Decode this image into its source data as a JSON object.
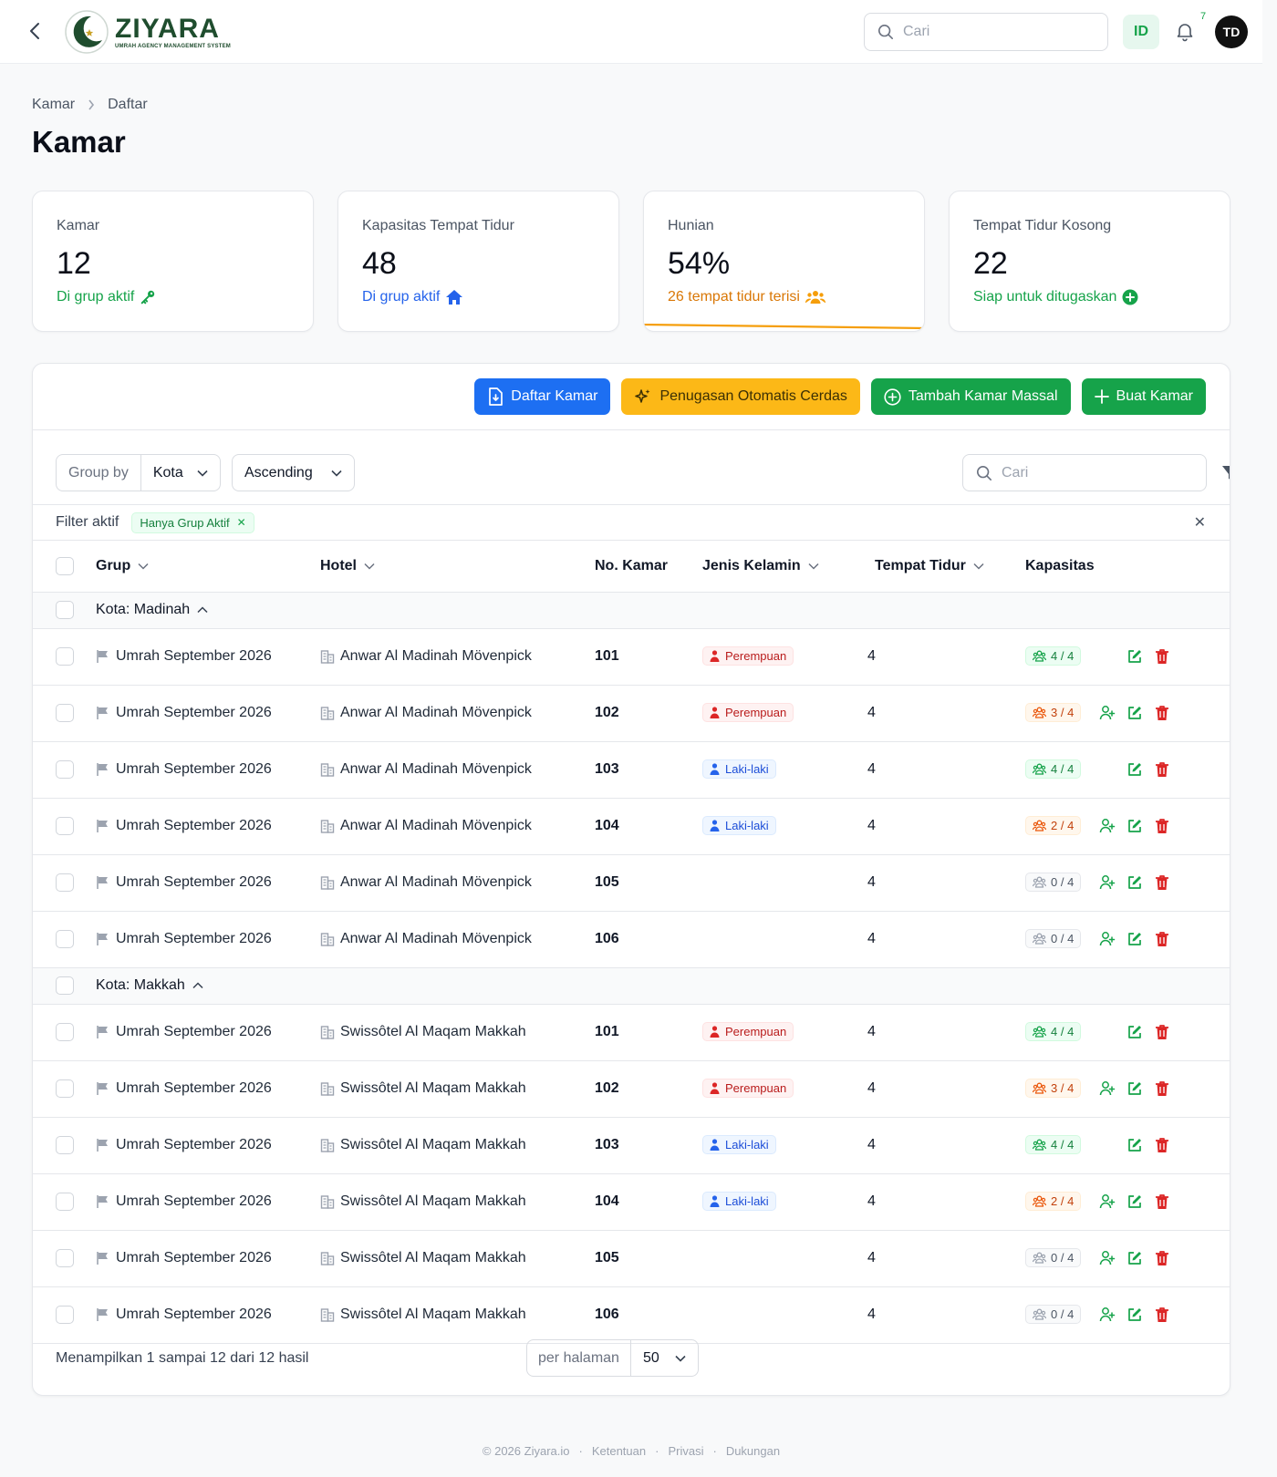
{
  "header": {
    "logo_text": "ZIYARA",
    "logo_sub": "UMRAH AGENCY MANAGEMENT SYSTEM",
    "search_placeholder": "Cari",
    "lang": "ID",
    "notif_count": "7",
    "avatar": "TD"
  },
  "breadcrumb": [
    "Kamar",
    "Daftar"
  ],
  "page_title": "Kamar",
  "stats": [
    {
      "label": "Kamar",
      "value": "12",
      "desc": "Di grup aktif",
      "icon": "key-icon",
      "color": "#16a34a"
    },
    {
      "label": "Kapasitas Tempat Tidur",
      "value": "48",
      "desc": "Di grup aktif",
      "icon": "home-icon",
      "color": "#2563eb"
    },
    {
      "label": "Hunian",
      "value": "54%",
      "desc": "26 tempat tidur terisi",
      "icon": "users-icon",
      "color": "#d97706",
      "progress": 0.54
    },
    {
      "label": "Tempat Tidur Kosong",
      "value": "22",
      "desc": "Siap untuk ditugaskan",
      "icon": "plus-circle-icon",
      "color": "#16a34a"
    }
  ],
  "actions": {
    "list": "Daftar Kamar",
    "auto": "Penugasan Otomatis Cerdas",
    "bulk": "Tambah Kamar Massal",
    "create": "Buat Kamar"
  },
  "toolbar": {
    "group_by_label": "Group by",
    "group_by_value": "Kota",
    "sort_value": "Ascending",
    "search_placeholder": "Cari",
    "filter_count": "1"
  },
  "filters": {
    "title": "Filter aktif",
    "chip": "Hanya Grup Aktif"
  },
  "columns": {
    "grup": "Grup",
    "hotel": "Hotel",
    "no": "No. Kamar",
    "jk": "Jenis Kelamin",
    "tt": "Tempat Tidur",
    "kap": "Kapasitas"
  },
  "groups": [
    {
      "label": "Kota: Madinah",
      "rows": [
        {
          "grup": "Umrah September 2026",
          "hotel": "Anwar Al Madinah Mövenpick",
          "no": "101",
          "gender": "Perempuan",
          "beds": "4",
          "cap": "4 / 4",
          "cap_state": "full",
          "assign": false
        },
        {
          "grup": "Umrah September 2026",
          "hotel": "Anwar Al Madinah Mövenpick",
          "no": "102",
          "gender": "Perempuan",
          "beds": "4",
          "cap": "3 / 4",
          "cap_state": "part",
          "assign": true
        },
        {
          "grup": "Umrah September 2026",
          "hotel": "Anwar Al Madinah Mövenpick",
          "no": "103",
          "gender": "Laki-laki",
          "beds": "4",
          "cap": "4 / 4",
          "cap_state": "full",
          "assign": false
        },
        {
          "grup": "Umrah September 2026",
          "hotel": "Anwar Al Madinah Mövenpick",
          "no": "104",
          "gender": "Laki-laki",
          "beds": "4",
          "cap": "2 / 4",
          "cap_state": "part",
          "assign": true
        },
        {
          "grup": "Umrah September 2026",
          "hotel": "Anwar Al Madinah Mövenpick",
          "no": "105",
          "gender": "",
          "beds": "4",
          "cap": "0 / 4",
          "cap_state": "empty",
          "assign": true
        },
        {
          "grup": "Umrah September 2026",
          "hotel": "Anwar Al Madinah Mövenpick",
          "no": "106",
          "gender": "",
          "beds": "4",
          "cap": "0 / 4",
          "cap_state": "empty",
          "assign": true
        }
      ]
    },
    {
      "label": "Kota: Makkah",
      "rows": [
        {
          "grup": "Umrah September 2026",
          "hotel": "Swissôtel Al Maqam Makkah",
          "no": "101",
          "gender": "Perempuan",
          "beds": "4",
          "cap": "4 / 4",
          "cap_state": "full",
          "assign": false
        },
        {
          "grup": "Umrah September 2026",
          "hotel": "Swissôtel Al Maqam Makkah",
          "no": "102",
          "gender": "Perempuan",
          "beds": "4",
          "cap": "3 / 4",
          "cap_state": "part",
          "assign": true
        },
        {
          "grup": "Umrah September 2026",
          "hotel": "Swissôtel Al Maqam Makkah",
          "no": "103",
          "gender": "Laki-laki",
          "beds": "4",
          "cap": "4 / 4",
          "cap_state": "full",
          "assign": false
        },
        {
          "grup": "Umrah September 2026",
          "hotel": "Swissôtel Al Maqam Makkah",
          "no": "104",
          "gender": "Laki-laki",
          "beds": "4",
          "cap": "2 / 4",
          "cap_state": "part",
          "assign": true
        },
        {
          "grup": "Umrah September 2026",
          "hotel": "Swissôtel Al Maqam Makkah",
          "no": "105",
          "gender": "",
          "beds": "4",
          "cap": "0 / 4",
          "cap_state": "empty",
          "assign": true
        },
        {
          "grup": "Umrah September 2026",
          "hotel": "Swissôtel Al Maqam Makkah",
          "no": "106",
          "gender": "",
          "beds": "4",
          "cap": "0 / 4",
          "cap_state": "empty",
          "assign": true
        }
      ]
    }
  ],
  "pagination": {
    "showing": "Menampilkan 1 sampai 12 dari 12 hasil",
    "per_page_label": "per halaman",
    "per_page_value": "50"
  },
  "footer": {
    "copyright": "© 2026 Ziyara.io",
    "links": [
      "Ketentuan",
      "Privasi",
      "Dukungan"
    ]
  }
}
